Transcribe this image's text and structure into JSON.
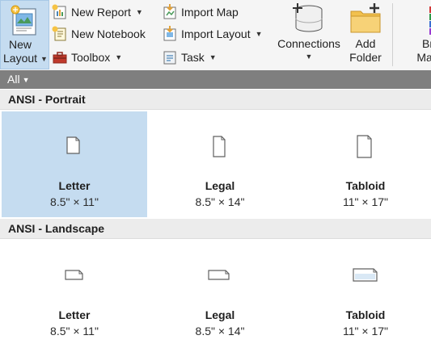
{
  "ribbon": {
    "new_layout": "New Layout",
    "new_report": "New Report",
    "new_notebook": "New Notebook",
    "toolbox": "Toolbox",
    "import_map": "Import Map",
    "import_layout": "Import Layout",
    "task": "Task",
    "connections": "Connections",
    "add_folder": "Add Folder",
    "browse_maps_partial": "Br Map"
  },
  "filter": {
    "label": "All"
  },
  "groups": [
    {
      "title": "ANSI - Portrait",
      "items": [
        {
          "name": "Letter",
          "size": "8.5\" × 11\"",
          "selected": true
        },
        {
          "name": "Legal",
          "size": "8.5\" × 14\"",
          "selected": false
        },
        {
          "name": "Tabloid",
          "size": "11\" × 17\"",
          "selected": false
        }
      ]
    },
    {
      "title": "ANSI - Landscape",
      "items": [
        {
          "name": "Letter",
          "size": "8.5\" × 11\"",
          "selected": false
        },
        {
          "name": "Legal",
          "size": "8.5\" × 14\"",
          "selected": false
        },
        {
          "name": "Tabloid",
          "size": "11\" × 17\"",
          "selected": false
        }
      ]
    }
  ],
  "colors": {
    "selection": "#c5dcf0",
    "filter_bar": "#7f7f7f",
    "group_header": "#ececec"
  }
}
